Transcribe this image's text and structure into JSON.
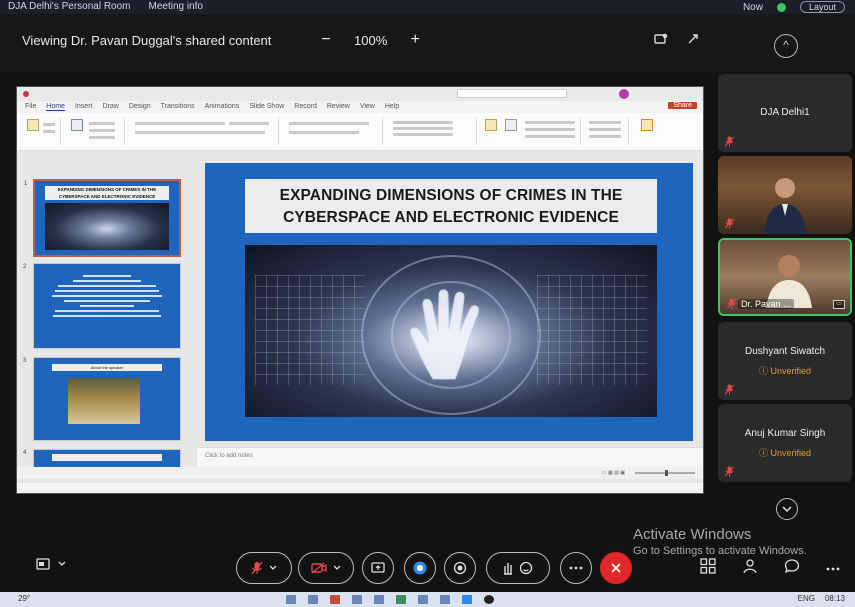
{
  "top_strip": {
    "left_items": [
      "DJA Delhi's Personal Room",
      "Meeting info"
    ],
    "right_items": [
      "Now",
      "Layout"
    ]
  },
  "header": {
    "title": "Viewing Dr. Pavan Duggal's shared content",
    "zoom_minus": "−",
    "zoom_level": "100%",
    "zoom_plus": "+",
    "collapse": "^"
  },
  "slide": {
    "title_line1": "EXPANDING DIMENSIONS OF CRIMES IN THE",
    "title_line2": "CYBERSPACE AND ELECTRONIC EVIDENCE",
    "notes_placeholder": "Click to add notes"
  },
  "thumbnails": [
    {
      "num": "1",
      "title": "EXPANDING DIMENSIONS OF CRIMES IN THE CYBERSPACE AND ELECTRONIC EVIDENCE"
    },
    {
      "num": "2"
    },
    {
      "num": "3",
      "caption": "About the speaker"
    },
    {
      "num": "4"
    }
  ],
  "ppt_menu": [
    "File",
    "Home",
    "Insert",
    "Draw",
    "Design",
    "Transitions",
    "Animations",
    "Slide Show",
    "Record",
    "Review",
    "View",
    "Help"
  ],
  "ppt_share": "Share",
  "participants": [
    {
      "name": "DJA Delhi1",
      "status": ""
    },
    {
      "name": "",
      "status": ""
    },
    {
      "name": "Dr. Pavan ...",
      "status": ""
    },
    {
      "name": "Dushyant Siwatch",
      "status": "Unverified"
    },
    {
      "name": "Anuj Kumar Singh",
      "status": "Unverified"
    }
  ],
  "watermark": {
    "line1": "Activate Windows",
    "line2": "Go to Settings to activate Windows."
  },
  "taskbar": {
    "left": "29°",
    "lang": "ENG",
    "time": "08:13"
  },
  "colors": {
    "end_call": "#e02828",
    "active_speaker": "#38c56b",
    "unverified": "#e0a230",
    "slide_bg": "#1f64bd",
    "muted": "#e24b4b"
  }
}
